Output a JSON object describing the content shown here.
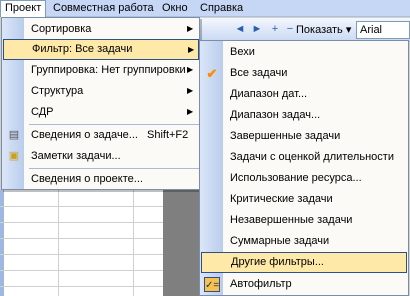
{
  "menubar": {
    "items": [
      "Проект",
      "Совместная работа",
      "Окно",
      "Справка"
    ]
  },
  "toolbar": {
    "show_label": "Показать ▾",
    "font_value": "Arial"
  },
  "menu": {
    "items": [
      {
        "label": "Сортировка",
        "has_submenu": true
      },
      {
        "label": "Фильтр: Все задачи",
        "has_submenu": true,
        "highlighted": true
      },
      {
        "label": "Группировка: Нет группировки",
        "has_submenu": true
      },
      {
        "label": "Структура",
        "has_submenu": true
      },
      {
        "label": "СДР",
        "has_submenu": true
      },
      {
        "label": "Сведения о задаче...",
        "shortcut": "Shift+F2"
      },
      {
        "label": "Заметки задачи..."
      },
      {
        "label": "Сведения о проекте..."
      }
    ]
  },
  "submenu": {
    "items": [
      {
        "label": "Вехи"
      },
      {
        "label": "Все задачи",
        "checked": true
      },
      {
        "label": "Диапазон дат..."
      },
      {
        "label": "Диапазон задач..."
      },
      {
        "label": "Завершенные задачи"
      },
      {
        "label": "Задачи с оценкой длительности"
      },
      {
        "label": "Использование ресурса..."
      },
      {
        "label": "Критические задачи"
      },
      {
        "label": "Незавершенные задачи"
      },
      {
        "label": "Суммарные задачи"
      },
      {
        "label": "Другие фильтры...",
        "highlighted": true
      },
      {
        "label": "Автофильтр",
        "icon": "autofilter-icon"
      }
    ]
  },
  "colors": {
    "highlight": "#ffe9a8",
    "highlight_border": "#2e4f8a",
    "check": "#ff8c00"
  }
}
